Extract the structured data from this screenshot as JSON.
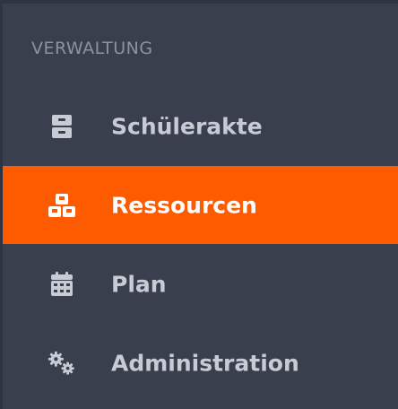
{
  "sidebar": {
    "section_title": "VERWALTUNG",
    "items": [
      {
        "label": "Schülerakte",
        "icon": "archive-icon",
        "active": false
      },
      {
        "label": "Ressourcen",
        "icon": "cubes-icon",
        "active": true
      },
      {
        "label": "Plan",
        "icon": "calendar-icon",
        "active": false
      },
      {
        "label": "Administration",
        "icon": "gears-icon",
        "active": false
      }
    ]
  },
  "colors": {
    "background": "#3a3f4e",
    "accent": "#fe5a00",
    "text": "#c7cbd4",
    "section_title": "#8d92a0"
  }
}
